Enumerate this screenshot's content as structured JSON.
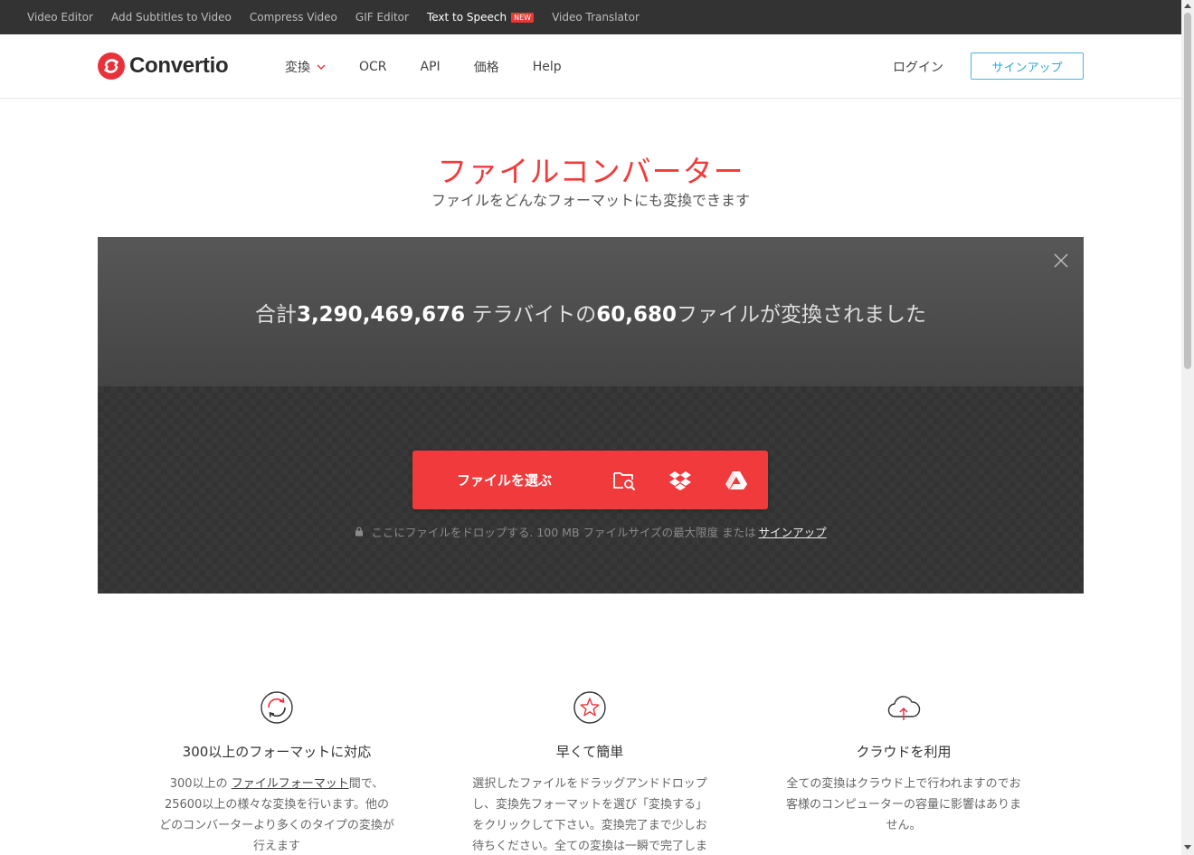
{
  "topbar": {
    "links": [
      "Video Editor",
      "Add Subtitles to Video",
      "Compress Video",
      "GIF Editor",
      "Text to Speech",
      "Video Translator"
    ],
    "new_badge": "NEW"
  },
  "header": {
    "logo_text": "Convertio",
    "nav": [
      "変換",
      "OCR",
      "API",
      "価格",
      "Help"
    ],
    "login": "ログイン",
    "signup": "サインアップ"
  },
  "hero": {
    "title": "ファイルコンバーター",
    "subtitle": "ファイルをどんなフォーマットにも変換できます"
  },
  "stats": {
    "prefix": "合計",
    "terabytes": "3,290,469,676",
    "middle": " テラバイトの",
    "files": "60,680",
    "suffix": "ファイルが変換されました"
  },
  "converter": {
    "choose_files": "ファイルを選ぶ",
    "drop_hint": "ここにファイルをドロップする. 100 MB ファイルサイズの最大限度 または",
    "signup_link": "サインアップ",
    "icons": [
      "folder-search-icon",
      "dropbox-icon",
      "google-drive-icon"
    ]
  },
  "features": [
    {
      "icon": "refresh-icon",
      "title": "300以上のフォーマットに対応",
      "text_before": "300以上の",
      "link": "ファイルフォーマット",
      "text_after": "間で、25600以上の様々な変換を行います。他のどのコンバーターより多くのタイプの変換が行えます"
    },
    {
      "icon": "star-icon",
      "title": "早くて簡単",
      "text": "選択したファイルをドラッグアンドドロップし、変換先フォーマットを選び「変換する」をクリックして下さい。変換完了まで少しお待ちください。全ての変換は一瞬で完了します。"
    },
    {
      "icon": "cloud-upload-icon",
      "title": "クラウドを利用",
      "text": "全ての変換はクラウド上で行われますのでお客様のコンピューターの容量に影響はありません。"
    }
  ],
  "colors": {
    "brand_red": "#f13a3c",
    "signup_blue": "#2fa6d3",
    "topbar": "#333333"
  }
}
